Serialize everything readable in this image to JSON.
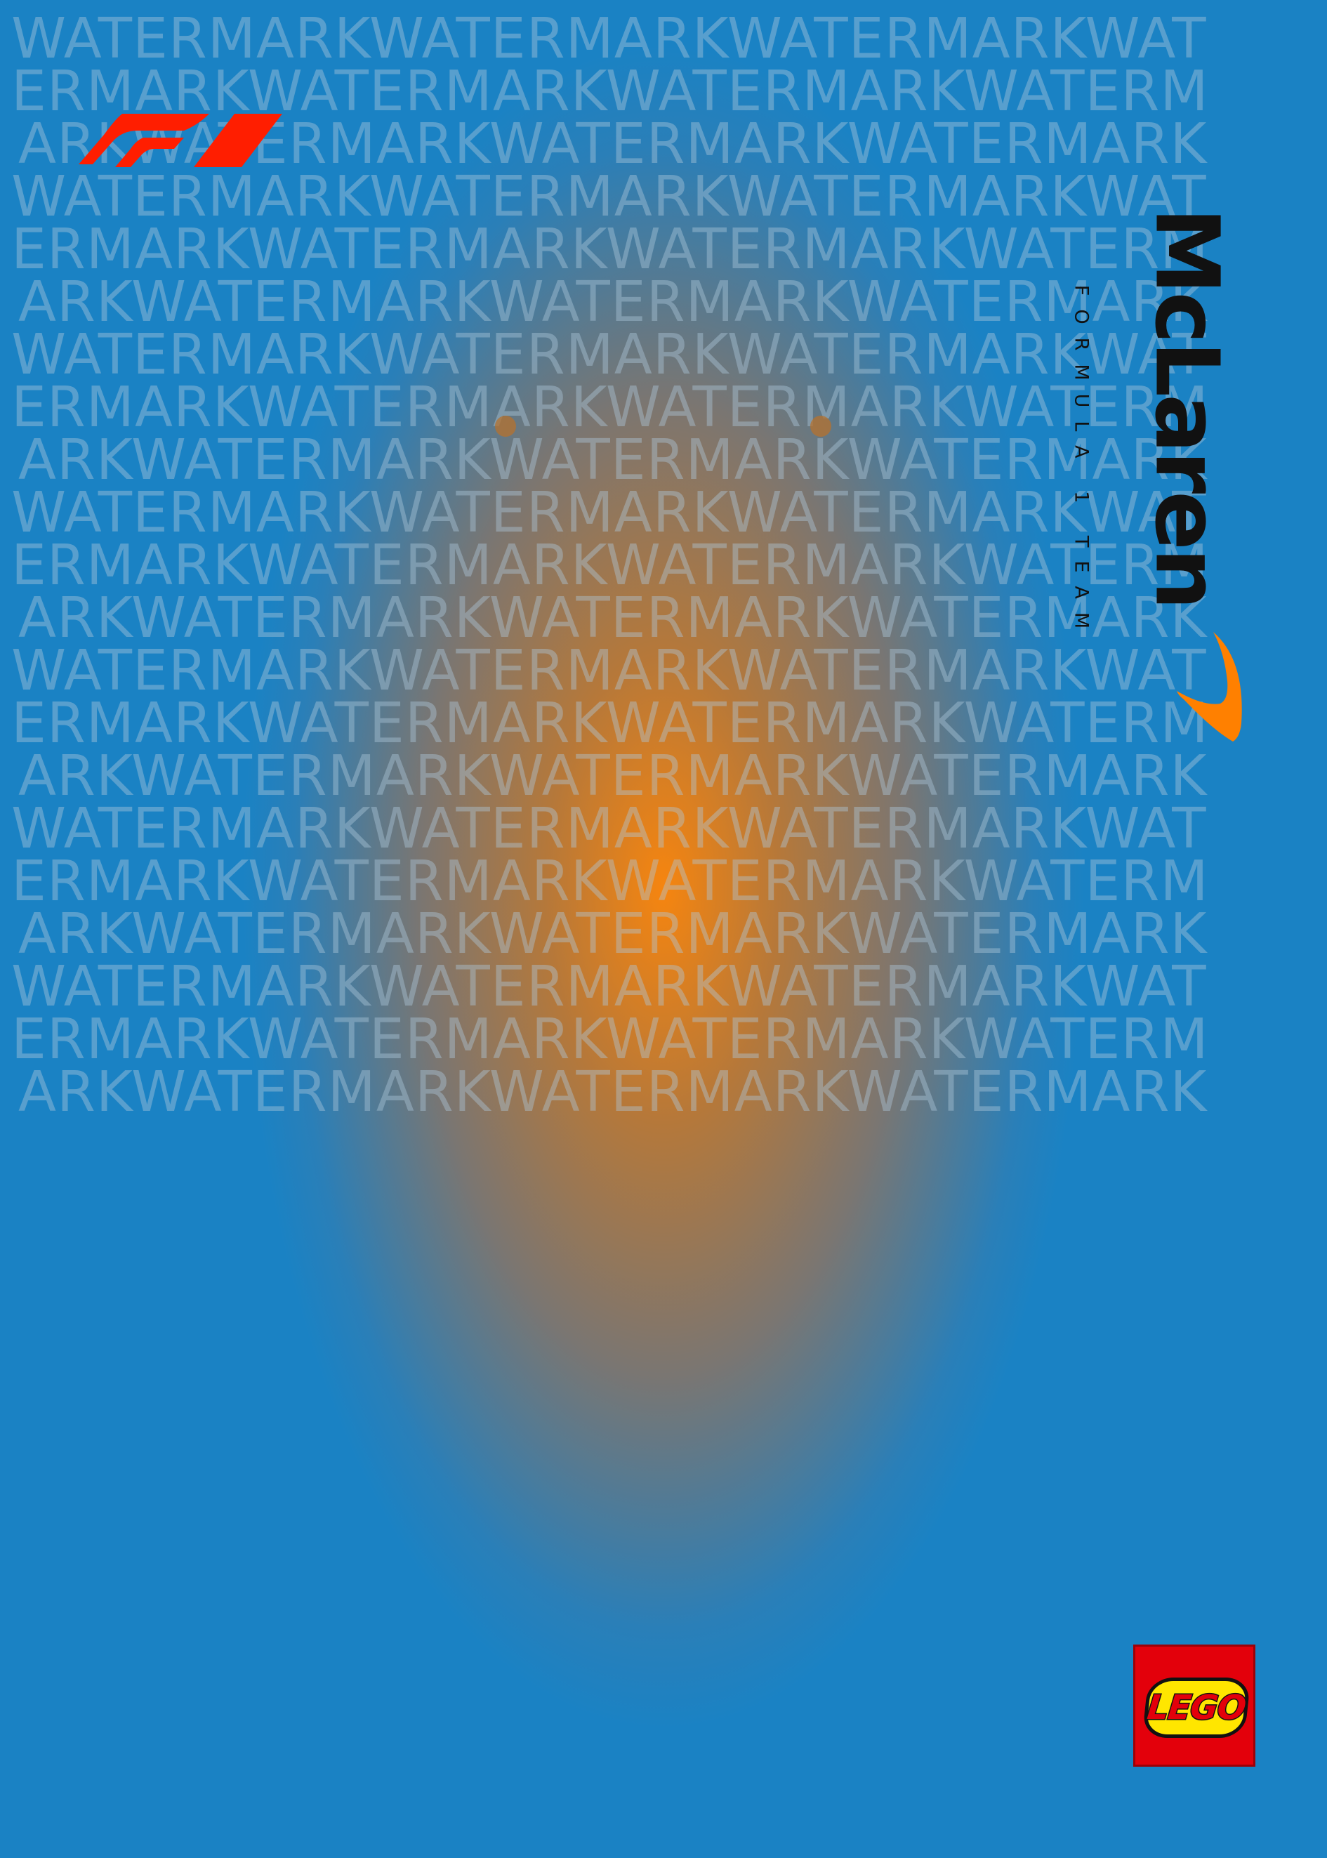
{
  "poster": {
    "background_colors": {
      "outer": "#1a82c4",
      "center": "#f6850f",
      "mid": "#7a7672"
    }
  },
  "watermark": {
    "rows": [
      "WATERMARKWATERMARKWATERMARKWAT",
      "ERMARKWATERMARKWATERMARKWATERM",
      "ARKWATERMARKWATERMARKWATERMARK",
      "WATERMARKWATERMARKWATERMARKWAT",
      "ERMARKWATERMARKWATERMARKWATERM",
      "ARKWATERMARKWATERMARKWATERMARK",
      "WATERMARKWATERMARKWATERMARKWAT",
      "ERMARKWATERMARKWATERMARKWATERM",
      "ARKWATERMARKWATERMARKWATERMARK",
      "WATERMARKWATERMARKWATERMARKWAT",
      "ERMARKWATERMARKWATERMARKWATERM",
      "ARKWATERMARKWATERMARKWATERMARK",
      "WATERMARKWATERMARKWATERMARKWAT",
      "ERMARKWATERMARKWATERMARKWATERM",
      "ARKWATERMARKWATERMARKWATERMARK",
      "WATERMARKWATERMARKWATERMARKWAT",
      "ERMARKWATERMARKWATERMARKWATERM",
      "ARKWATERMARKWATERMARKWATERMARK",
      "WATERMARKWATERMARKWATERMARKWAT",
      "ERMARKWATERMARKWATERMARKWATERM",
      "ARKWATERMARKWATERMARKWATERMARK"
    ],
    "color": "rgba(175, 200, 220, 0.42)"
  },
  "logos": {
    "f1": {
      "icon": "f1-logo",
      "color": "#ff1e00"
    },
    "mclaren": {
      "icon": "mclaren-logo",
      "wordmark": "McLaren",
      "subtitle": "FORMULA 1 TEAM",
      "speedmark_color": "#ff8000",
      "text_color": "#111111"
    },
    "lego": {
      "icon": "lego-logo",
      "text": "LEGO",
      "red": "#e3000b",
      "yellow": "#ffe600"
    }
  }
}
